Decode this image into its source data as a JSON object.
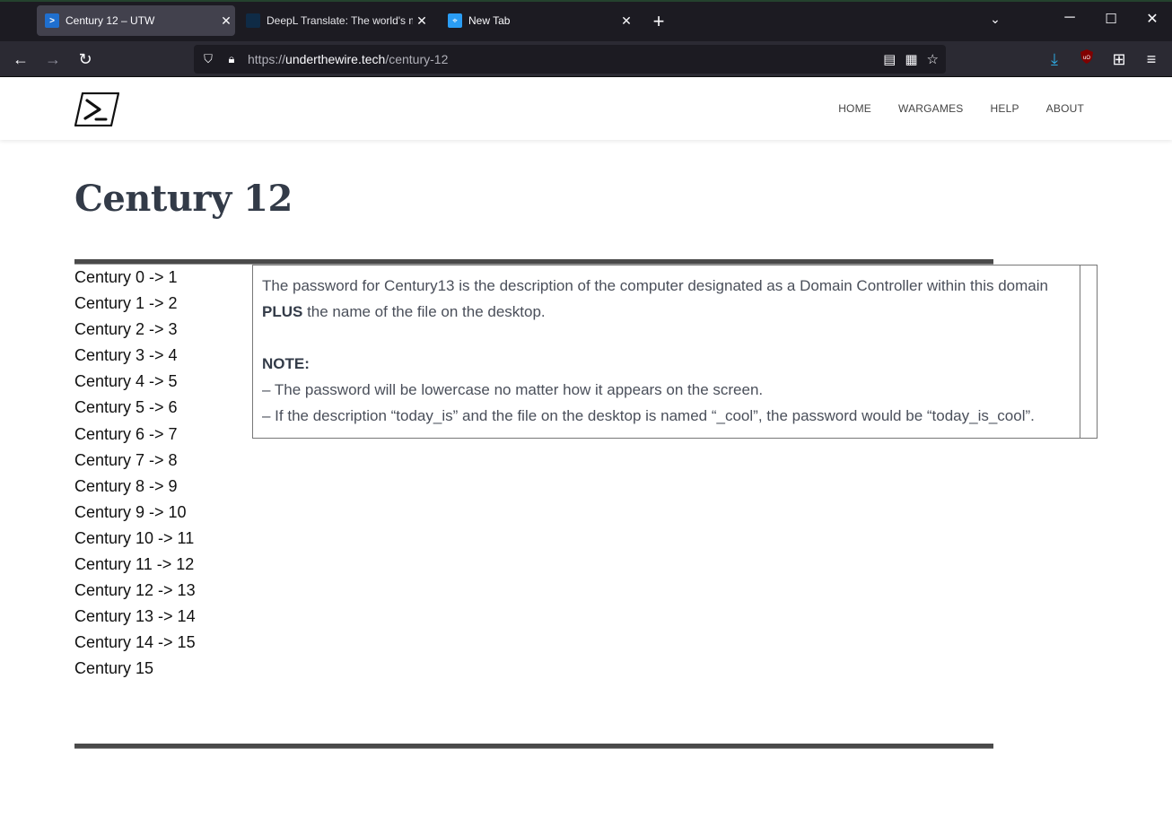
{
  "browser": {
    "tabs": [
      {
        "title": "Century 12 – UTW",
        "active": true,
        "icon": "powershell-icon"
      },
      {
        "title": "DeepL Translate: The world's most accurate translator",
        "active": false,
        "icon": "deepl-icon"
      },
      {
        "title": "New Tab",
        "active": false,
        "icon": "firefox-newtab-icon"
      }
    ],
    "url": {
      "scheme": "https://",
      "host": "underthewire.tech",
      "path": "/century-12"
    }
  },
  "site": {
    "nav": [
      "HOME",
      "WARGAMES",
      "HELP",
      "ABOUT"
    ],
    "page_title": "Century 12",
    "levels": [
      "Century 0 -> 1",
      "Century 1 -> 2",
      "Century 2 -> 3",
      "Century 3 -> 4",
      "Century 4 -> 5",
      "Century 5 -> 6",
      "Century 6 -> 7",
      "Century 7 -> 8",
      "Century 8 -> 9",
      "Century 9 -> 10",
      "Century 10 -> 11",
      "Century 11 -> 12",
      "Century 12 -> 13",
      "Century 13 -> 14",
      "Century 14 -> 15",
      "Century 15"
    ],
    "description": {
      "line1_pre": "The password for Century13 is the description of the computer designated as a Domain Controller within this domain ",
      "line1_bold": "PLUS",
      "line1_post": " the name of the file on the desktop.",
      "note_label": "NOTE:",
      "note1": "– The password will be lowercase no matter how it appears on the screen.",
      "note2": "– If the description “today_is” and the file on the desktop is named “_cool”, the password would be “today_is_cool”."
    }
  }
}
